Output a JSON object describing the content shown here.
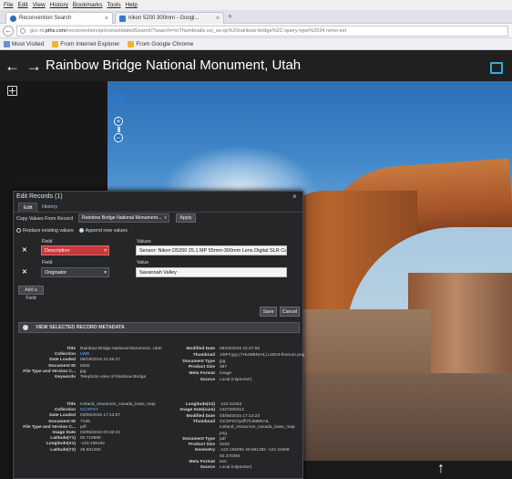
{
  "browser": {
    "menu": [
      "File",
      "Edit",
      "View",
      "History",
      "Bookmarks",
      "Tools",
      "Help"
    ],
    "tabs": [
      {
        "label": "Reconvention Search",
        "active": true
      },
      {
        "label": "nikon 5200 300mm - Googl...",
        "active": false
      }
    ],
    "new_tab": "+",
    "url_prefix": "gcc-nt.",
    "url_domain": "pths.com",
    "url_rest": "/reconvention/spi/consolidatedSearch/?search=!vrThumbnails.xxl_as-qc%20rainbow-bridge%2C-query-type%2034 remo-ext",
    "bookmarks": [
      "Most Visited",
      "From Internet Explorer",
      "From Google Chrome"
    ]
  },
  "app": {
    "nav_arrows": "← →",
    "title": "Rainbow Bridge National Monument, Utah"
  },
  "viewer": {
    "zoom_in": "+",
    "zoom_out": "−",
    "up_arrow": "↑"
  },
  "dialog": {
    "title": "Edit Records (1)",
    "close": "×",
    "tabs": [
      "Edit",
      "History"
    ],
    "copy_label": "Copy Values From Record",
    "copy_select": "Rainbow Bridge National Monument...",
    "apply": "Apply",
    "replace_label": "Replace existing values",
    "append_label": "Append new values",
    "fields": [
      {
        "field_label": "Field",
        "field": "Description",
        "value_label": "Values",
        "value": "Sensor: Nikon D5200 25.1 MP 55mm-300mm Lens Digital SLR Camera"
      },
      {
        "field_label": "Field",
        "field": "Originator",
        "value_label": "Value",
        "value": "Savannah Valley"
      }
    ],
    "add_field": "Add a Field",
    "save": "Save",
    "cancel": "Cancel",
    "selected_header": "VIEW SELECTED RECORD METADATA"
  },
  "metadata": {
    "left_a": [
      {
        "k": "Title",
        "v": "Rainbow Bridge National Monument, Utah"
      },
      {
        "k": "Collection",
        "v": "LWD",
        "link": true
      },
      {
        "k": "Date Loaded",
        "v": "06/18/2015 22:46:47"
      },
      {
        "k": "Document ID",
        "v": "8282"
      },
      {
        "k": "File Type and Version C...",
        "v": "jpg"
      },
      {
        "k": "Keywords",
        "v": "Telephoto view of Rainbow Bridge"
      }
    ],
    "right_a": [
      {
        "k": "Modified Date",
        "v": "06/18/2015 22:47:56"
      },
      {
        "k": "Thumbnail",
        "v": "1/8FF.jpg (THUMBNAIL) LWD3-thonum.png"
      },
      {
        "k": "Document Type",
        "v": "jpg"
      },
      {
        "k": "Product Size",
        "v": "387"
      },
      {
        "k": "Meta Format",
        "v": "image"
      },
      {
        "k": "Source",
        "v": "Local (Hipsorter)"
      }
    ],
    "left_b": [
      {
        "k": "Title",
        "v": "Iceland_resources_canada_base_map"
      },
      {
        "k": "Collection",
        "v": "GCSPSY",
        "link": true
      },
      {
        "k": "Date Loaded",
        "v": "03/06/2015 17:13:07"
      },
      {
        "k": "Document ID",
        "v": "7139"
      },
      {
        "k": "File Type and Version C...",
        "v": "pdf"
      },
      {
        "k": "Image Date",
        "v": "03/06/2015 00:32:33"
      },
      {
        "k": "Latitude(Y1)",
        "v": "50.719556"
      },
      {
        "k": "Longitude(X1)",
        "v": "-123.155192"
      },
      {
        "k": "Latitude(Y2)",
        "v": "49.561282"
      }
    ],
    "right_b": [
      {
        "k": "Longitude(X2)",
        "v": "-122.42263"
      },
      {
        "k": "Image Date(sum)",
        "v": "1427266313"
      },
      {
        "k": "Modified Date",
        "v": "03/06/2015 17:14:23"
      },
      {
        "k": "Thumbnail",
        "v": "GCSPSY\\pdf\\7/UMBNAIL"
      },
      {
        "k": "",
        "v": "Iceland_resources_canada_base_map"
      },
      {
        "k": "",
        "v": "png"
      },
      {
        "k": "Document Type",
        "v": "pdf"
      },
      {
        "k": "Product Size",
        "v": "9183"
      },
      {
        "k": "Geometry",
        "v": "-123.155092 49.561282 -122.41968"
      },
      {
        "k": "",
        "v": "50.370394"
      },
      {
        "k": "Meta Format",
        "v": "text"
      },
      {
        "k": "Source",
        "v": "Local (Hipsorter)"
      }
    ]
  }
}
